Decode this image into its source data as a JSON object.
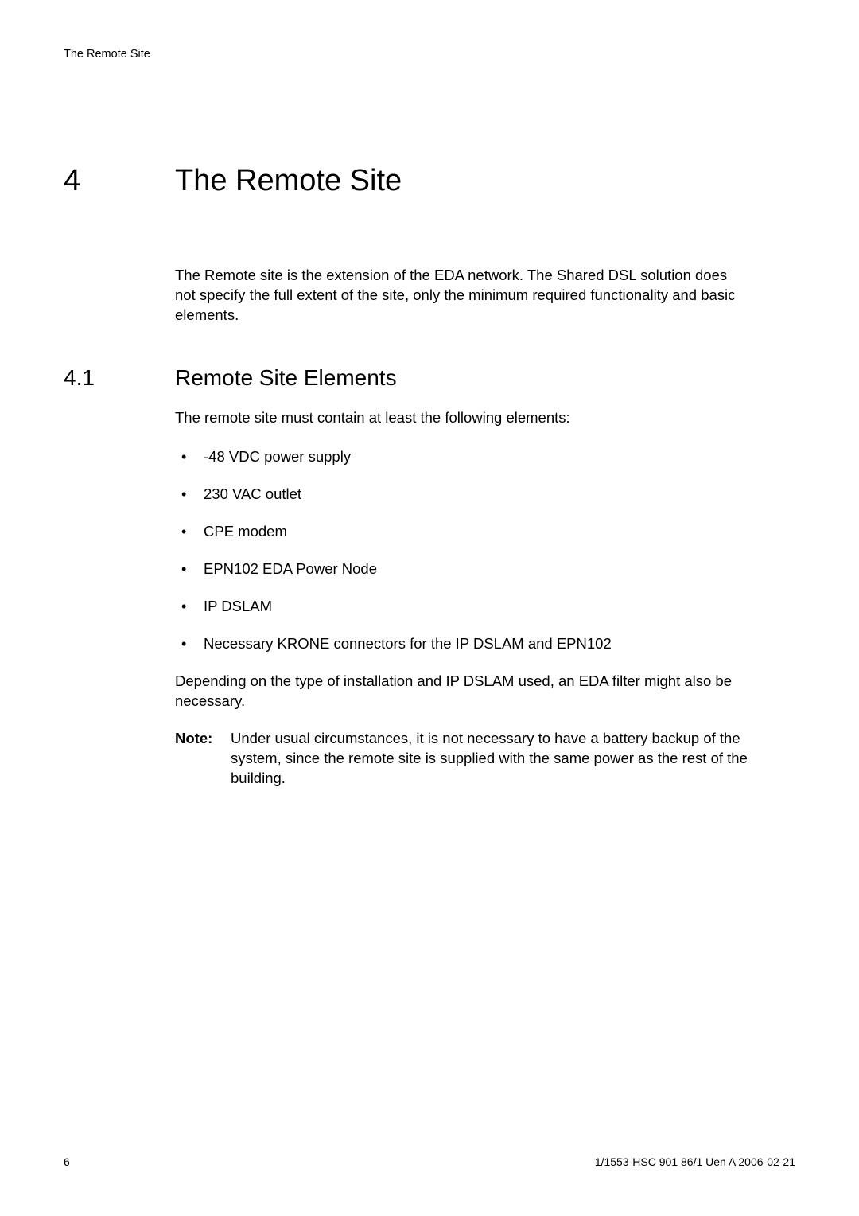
{
  "header": {
    "running_title": "The Remote Site"
  },
  "chapter": {
    "number": "4",
    "title": "The Remote Site",
    "intro": "The Remote site is the extension of the EDA network. The Shared DSL solution does not specify the full extent of the site, only the minimum required functionality and basic elements."
  },
  "section": {
    "number": "4.1",
    "title": "Remote Site Elements",
    "intro": "The remote site must contain at least the following elements:",
    "bullets": [
      "-48 VDC power supply",
      "230 VAC outlet",
      "CPE modem",
      "EPN102 EDA Power Node",
      "IP DSLAM",
      "Necessary KRONE connectors for the IP DSLAM and EPN102"
    ],
    "after_list": "Depending on the type of installation and IP DSLAM used, an EDA filter might also be necessary.",
    "note_label": "Note:",
    "note_body": "Under usual circumstances, it is not necessary to have a battery backup of the system, since the remote site is supplied with the same power as the rest of the building."
  },
  "footer": {
    "page": "6",
    "docref": "1/1553-HSC 901 86/1 Uen A   2006-02-21"
  }
}
